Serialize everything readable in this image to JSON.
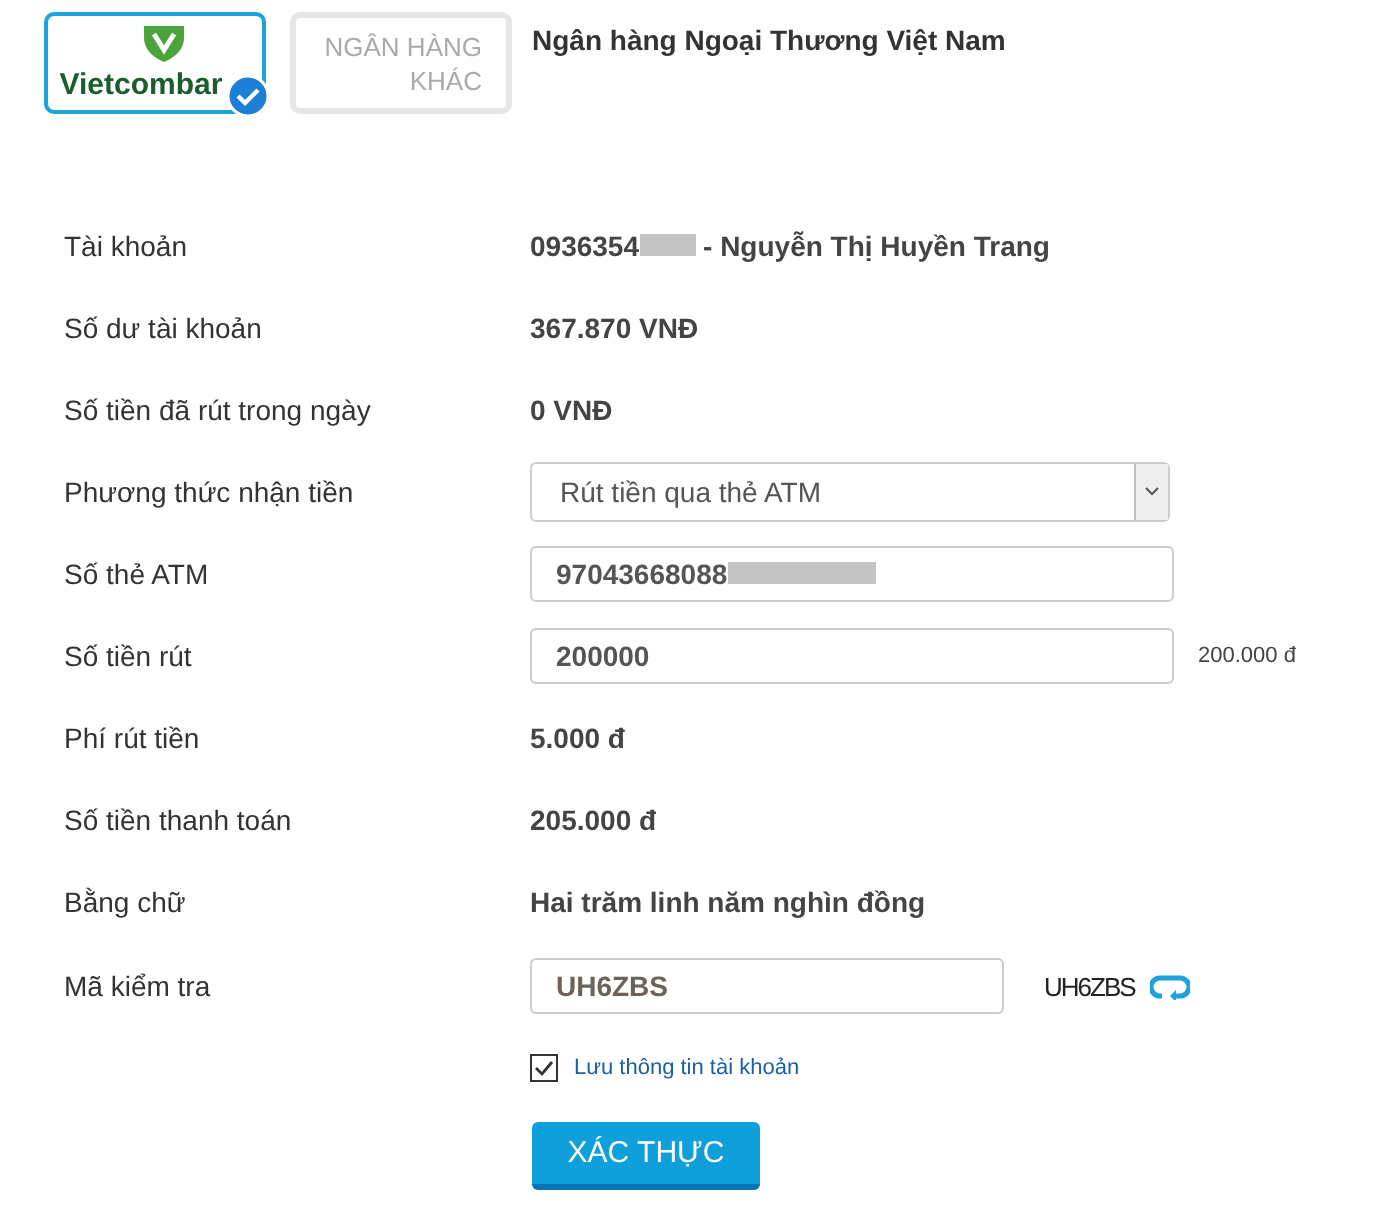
{
  "bank_tabs": [
    {
      "kind": "logo",
      "label": "Vietcombar",
      "selected": true
    },
    {
      "kind": "other",
      "label": "NGÂN HÀNG",
      "sublabel": "KHÁC",
      "selected": false
    }
  ],
  "bank_name": "Ngân hàng Ngoại Thương Việt Nam",
  "rows": [
    {
      "kind": "text",
      "label": "Tài khoản",
      "value": "0936354",
      "redacted": true,
      "suffix": "- Nguyễn Thị Huyền Trang"
    },
    {
      "kind": "text",
      "label": "Số dư tài khoản",
      "value": "367.870 VNĐ"
    },
    {
      "kind": "text",
      "label": "Số tiền đã rút trong ngày",
      "value": "0 VNĐ"
    },
    {
      "kind": "select",
      "label": "Phương thức nhận tiền",
      "value": "Rút tiền qua thẻ ATM"
    },
    {
      "kind": "input",
      "label": "Số thẻ ATM",
      "value": "97043668088",
      "redacted": true
    },
    {
      "kind": "input",
      "label": "Số tiền rút",
      "value": "200000",
      "note": "200.000 đ"
    },
    {
      "kind": "text",
      "label": "Phí rút tiền",
      "value": "5.000 đ"
    },
    {
      "kind": "text",
      "label": "Số tiền thanh toán",
      "value": "205.000 đ"
    },
    {
      "kind": "text",
      "label": "Bằng chữ",
      "value": "Hai trăm linh năm nghìn đồng"
    },
    {
      "kind": "captcha",
      "label": "Mã kiểm tra",
      "value": "UH6ZBS",
      "captcha": "UH6ZBS"
    }
  ],
  "remember": {
    "label": "Lưu thông tin tài khoản",
    "checked": true
  },
  "submit": "XÁC THỰC"
}
